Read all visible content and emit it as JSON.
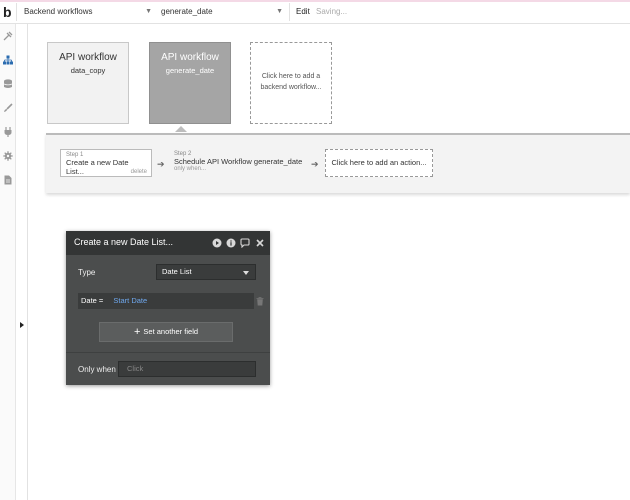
{
  "topbar": {
    "logo": "b",
    "page_select": "Backend workflows",
    "workflow_select": "generate_date",
    "edit_label": "Edit",
    "status_text": "Saving..."
  },
  "sidebar": {
    "icons": [
      "design-icon",
      "workflow-icon",
      "data-icon",
      "styles-icon",
      "plugins-icon",
      "settings-icon",
      "logs-icon"
    ]
  },
  "workflows": [
    {
      "title": "API workflow",
      "name": "data_copy"
    },
    {
      "title": "API workflow",
      "name": "generate_date"
    },
    {
      "add_text": "Click here to add a backend workflow..."
    }
  ],
  "steps": {
    "step1": {
      "label": "Step 1",
      "title": "Create a new Date List...",
      "delete": "delete"
    },
    "step2": {
      "label": "Step 2",
      "title": "Schedule API Workflow generate_date",
      "condition": "only when..."
    },
    "add_action": "Click here to add an action..."
  },
  "panel": {
    "title": "Create a new Date List...",
    "type_label": "Type",
    "type_value": "Date List",
    "field_name": "Date =",
    "field_value": "Start Date",
    "set_another": "Set another field",
    "only_when_label": "Only when",
    "only_when_placeholder": "Click"
  },
  "colors": {
    "panel_bg": "#4b4d4d",
    "panel_header": "#333535",
    "selected_card": "#a5a5a5",
    "dynamic_value": "#6fa8ee"
  }
}
